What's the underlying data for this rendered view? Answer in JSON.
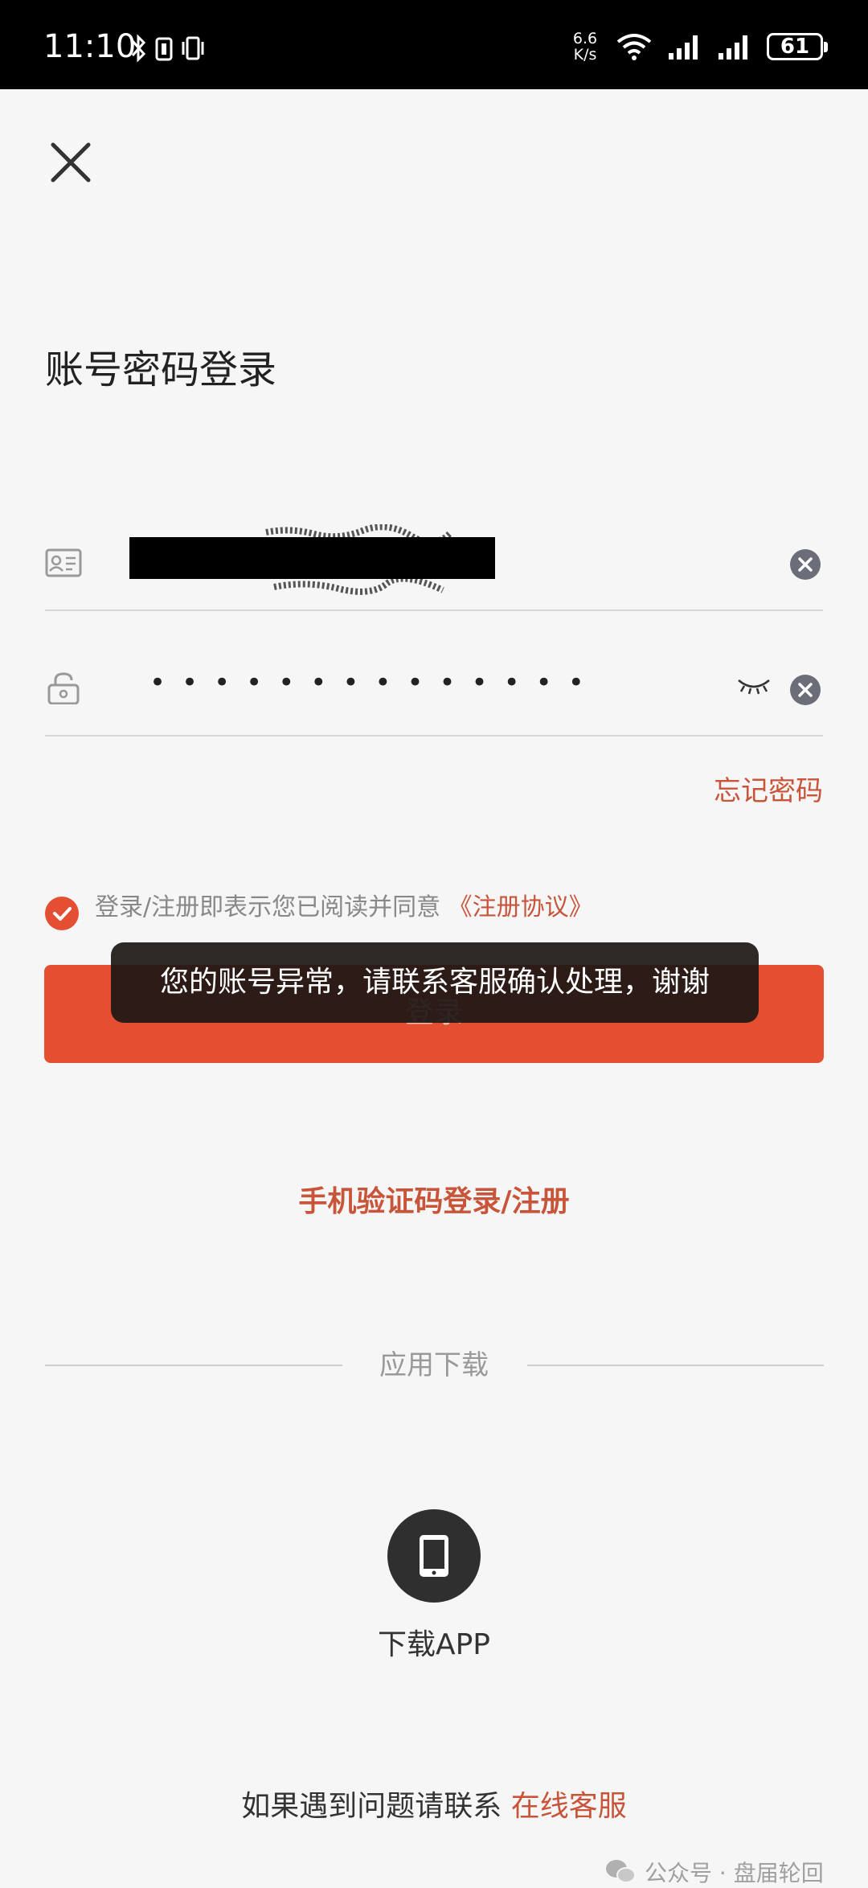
{
  "status_bar": {
    "time": "11:10",
    "net_speed_value": "6.6",
    "net_speed_unit": "K/s",
    "battery": "61"
  },
  "login": {
    "title": "账号密码登录",
    "password_mask": "••••••••••••••",
    "forgot_password": "忘记密码",
    "agreement_text": "登录/注册即表示您已阅读并同意",
    "agreement_link": "《注册协议》",
    "login_button": "登录",
    "sms_login": "手机验证码登录/注册"
  },
  "toast": {
    "message": "您的账号异常，请联系客服确认处理，谢谢"
  },
  "download": {
    "section_title": "应用下载",
    "app_label": "下载APP"
  },
  "footer": {
    "help_text": "如果遇到问题请联系",
    "help_link": "在线客服"
  },
  "watermark": {
    "text": "公众号 · 盘届轮回"
  },
  "colors": {
    "accent": "#e44f32",
    "link": "#c8553a",
    "background": "#f6f6f6"
  }
}
